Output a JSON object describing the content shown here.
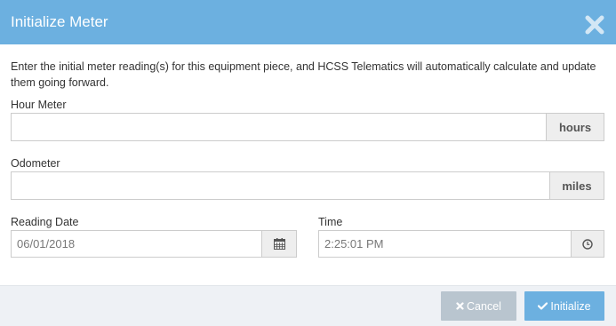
{
  "dialog": {
    "title": "Initialize Meter",
    "description": "Enter the initial meter reading(s) for this equipment piece, and HCSS Telematics will automatically calculate and update them going forward."
  },
  "hour_meter": {
    "label": "Hour Meter",
    "value": "",
    "unit": "hours"
  },
  "odometer": {
    "label": "Odometer",
    "value": "",
    "unit": "miles"
  },
  "reading_date": {
    "label": "Reading Date",
    "value": "06/01/2018",
    "icon": "calendar-icon"
  },
  "time": {
    "label": "Time",
    "value": "2:25:01 PM",
    "icon": "clock-icon"
  },
  "buttons": {
    "cancel": "Cancel",
    "initialize": "Initialize"
  },
  "colors": {
    "header": "#6cb0e0",
    "cancel_button": "#b9c5cf",
    "initialize_button": "#6cb0e0",
    "footer": "#eef1f5"
  }
}
